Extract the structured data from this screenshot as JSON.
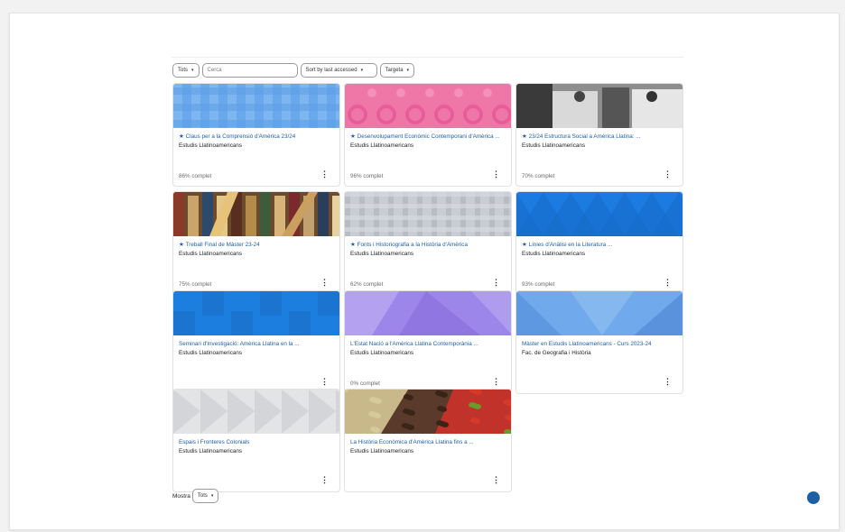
{
  "filters": {
    "grouping": "Tots",
    "search_placeholder": "Cerca",
    "sort": "Sort by last accessed",
    "view": "Targeta"
  },
  "courses": [
    {
      "starred": true,
      "title": "Claus per a la Comprensió d'Amèrica 23/24",
      "category": "Estudis Llatinoamericans",
      "progress": "86% complet",
      "image": "blue-squares"
    },
    {
      "starred": true,
      "title": "Desenvolupament Econòmic Contemporani d'Amèrica ...",
      "category": "Estudis Llatinoamericans",
      "progress": "96% complet",
      "image": "pink-circles"
    },
    {
      "starred": true,
      "title": "23/24 Estructura Social a Amèrica Llatina: ...",
      "category": "Estudis Llatinoamericans",
      "progress": "70% complet",
      "image": "historic-photo"
    },
    {
      "starred": true,
      "title": "Treball Final de Màster 23-24",
      "category": "Estudis Llatinoamericans",
      "progress": "75% complet",
      "image": "books"
    },
    {
      "starred": true,
      "title": "Fonts i Historiografia a la Història d'Amèrica",
      "category": "Estudis Llatinoamericans",
      "progress": "62% complet",
      "image": "grey-plaid"
    },
    {
      "starred": true,
      "title": "Línies d'Anàlisi en la Literatura ...",
      "category": "Estudis Llatinoamericans",
      "progress": "93% complet",
      "image": "blue-triangles"
    },
    {
      "starred": false,
      "title": "Seminari d'Investigació: Amèrica Llatina en la ...",
      "category": "Estudis Llatinoamericans",
      "progress": "",
      "image": "blue-blocks"
    },
    {
      "starred": false,
      "title": "L'Estat Nació a l'Amèrica Llatina Contemporània ...",
      "category": "Estudis Llatinoamericans",
      "progress": "0% complet",
      "image": "purple-geo"
    },
    {
      "starred": false,
      "title": "Màster en Estudis Llatinoamericans - Curs 2023-24",
      "category": "Fac. de Geografia i Història",
      "progress": "",
      "image": "lightblue-geo"
    },
    {
      "starred": false,
      "title": "Espais i Fronteres Colonials",
      "category": "Estudis Llatinoamericans",
      "progress": "",
      "image": "grey-triangles"
    },
    {
      "starred": false,
      "title": "La Història Econòmica d'Amèrica Llatina fins a ...",
      "category": "Estudis Llatinoamericans",
      "progress": "",
      "image": "coffee-beans"
    }
  ],
  "footer": {
    "show_label": "Mostra",
    "show_value": "Tots"
  },
  "icons": {
    "star": "★",
    "more": "⋮",
    "caret": "▾"
  }
}
